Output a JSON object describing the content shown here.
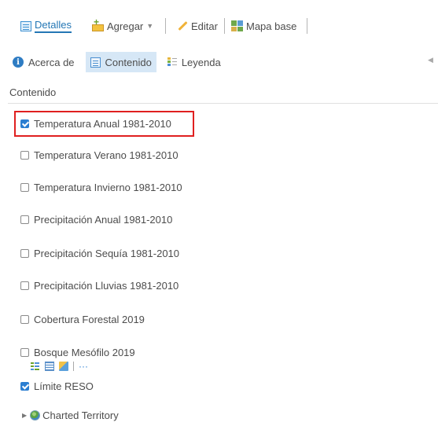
{
  "toolbar": {
    "detalles": "Detalles",
    "agregar": "Agregar",
    "editar": "Editar",
    "mapa_base": "Mapa base"
  },
  "tabs": [
    {
      "label": "Acerca de",
      "icon": "info-icon"
    },
    {
      "label": "Contenido",
      "icon": "content-icon",
      "active": true
    },
    {
      "label": "Leyenda",
      "icon": "legend-icon"
    }
  ],
  "section": {
    "title": "Contenido"
  },
  "layers": [
    {
      "label": "Temperatura Anual 1981-2010",
      "checked": true
    },
    {
      "label": "Temperatura Verano 1981-2010",
      "checked": false
    },
    {
      "label": "Temperatura Invierno 1981-2010",
      "checked": false
    },
    {
      "label": "Precipitación Anual 1981-2010",
      "checked": false
    },
    {
      "label": "Precipitación Sequía 1981-2010",
      "checked": false
    },
    {
      "label": "Precipitación Lluvias 1981-2010",
      "checked": false
    },
    {
      "label": "Cobertura Forestal 2019",
      "checked": false
    },
    {
      "label": "Bosque Mesófilo 2019",
      "checked": false
    },
    {
      "label": "Límite RESO",
      "checked": true
    }
  ],
  "layer_tools": {
    "more": "···"
  },
  "group": {
    "label": "Charted Territory"
  },
  "colors": {
    "accent": "#2477b5",
    "highlight": "#e02020",
    "active_tab": "#d6e7f6"
  }
}
